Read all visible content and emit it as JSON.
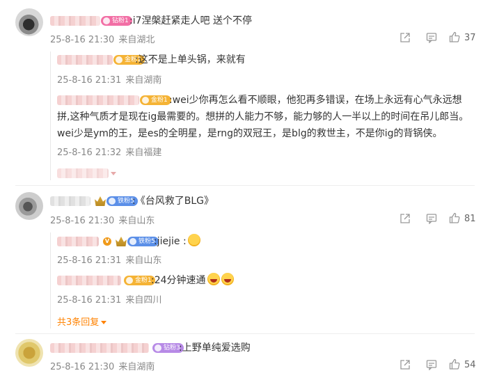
{
  "comments": [
    {
      "badge": "钻粉1",
      "text": ":i7涅槃赶紧走人吧 送个不停",
      "date": "25-8-16 21:30",
      "location": "来自湖北",
      "likes": "37",
      "replies": [
        {
          "badge": "金粉1",
          "text": ":这不是上单头锅，来就有",
          "date": "25-8-16 21:31",
          "location": "来自湖南"
        },
        {
          "badge": "金粉1",
          "text": ":wei少你再怎么看不顺眼，他犯再多错误，在场上永远有心气永远想拼,这种气质才是现在ig最需要的。想拼的人能力不够，能力够的人一半以上的时间在吊儿郎当。wei少是ym的王，是es的全明星，是rng的双冠王，是blg的救世主，不是你ig的背锅侠。",
          "date": "25-8-16 21:32",
          "location": "来自福建"
        }
      ]
    },
    {
      "badge": "铁粉5",
      "text": ":《台风救了BLG》",
      "date": "25-8-16 21:30",
      "location": "来自山东",
      "likes": "81",
      "replies": [
        {
          "badge": "铁粉5",
          "verified": "V",
          "text": ":jiejie :",
          "date": "25-8-16 21:31",
          "location": "来自山东"
        },
        {
          "badge": "金粉1",
          "text": ":24分钟速通",
          "date": "25-8-16 21:31",
          "location": "来自四川"
        }
      ],
      "more_replies": "共3条回复"
    },
    {
      "badge": "钻粉3",
      "text": ":上野单纯爱选购",
      "date": "25-8-16 21:30",
      "location": "来自湖南",
      "likes": "54"
    }
  ],
  "icons": {
    "share": "share-icon",
    "comment": "comment-icon",
    "like": "thumbs-up-icon"
  },
  "colors": {
    "accent": "#ff8200",
    "meta": "#888888"
  }
}
